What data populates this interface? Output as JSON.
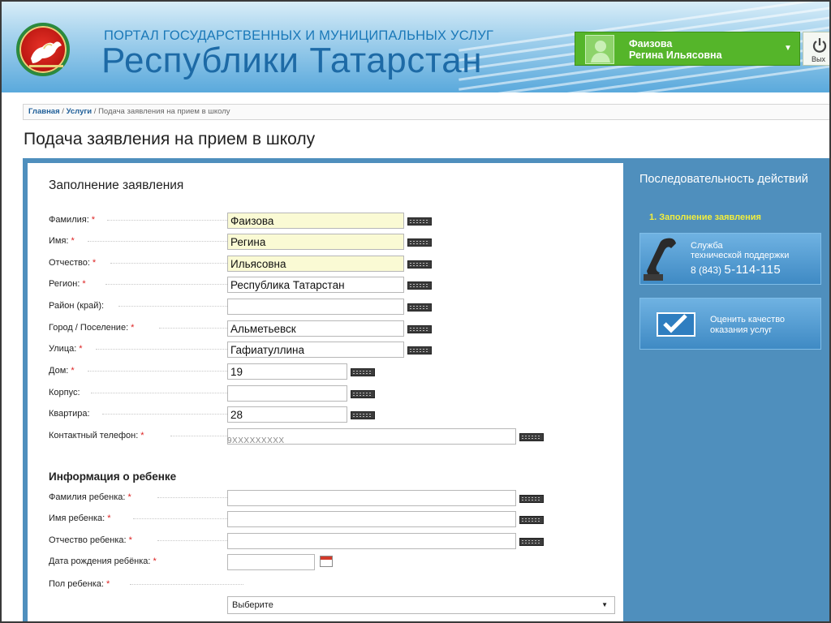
{
  "header": {
    "subtitle": "ПОРТАЛ ГОСУДАРСТВЕННЫХ И МУНИЦИПАЛЬНЫХ УСЛУГ",
    "title": "Республики Татарстан",
    "user_line1": "Фаизова",
    "user_line2": "Регина Ильясовна",
    "logout_label": "Вых"
  },
  "breadcrumb": {
    "home": "Главная",
    "services": "Услуги",
    "current": "Подача заявления на прием в школу"
  },
  "page_title": "Подача заявления на прием в школу",
  "form": {
    "section_title": "Заполнение заявления",
    "fields": [
      {
        "label": "Фамилия:",
        "value": "Фаизова"
      },
      {
        "label": "Имя:",
        "value": "Регина"
      },
      {
        "label": "Отчество:",
        "value": "Ильясовна"
      },
      {
        "label": "Регион:",
        "value": "Республика Татарстан"
      },
      {
        "label": "Район (край):",
        "value": ""
      },
      {
        "label": "Город / Поселение:",
        "value": "Альметьевск"
      },
      {
        "label": "Улица:",
        "value": "Гафиатуллина"
      },
      {
        "label": "Дом:",
        "value": "19"
      },
      {
        "label": "Корпус:",
        "value": ""
      },
      {
        "label": "Квартира:",
        "value": "28"
      },
      {
        "label": "Контактный телефон:",
        "value": ""
      }
    ],
    "phone_hint": "9XXXXXXXXX",
    "child_section_title": "Информация о ребенке",
    "child_fields": [
      {
        "label": "Фамилия ребенка:",
        "value": ""
      },
      {
        "label": "Имя ребенка:",
        "value": ""
      },
      {
        "label": "Отчество ребенка:",
        "value": ""
      },
      {
        "label": "Дата рождения ребёнка:",
        "value": ""
      }
    ],
    "gender_label": "Пол ребенка:",
    "gender_select": "Выберите",
    "required_mark": "*"
  },
  "sidebar": {
    "title": "Последовательность действий",
    "step": "1.  Заполнение заявления",
    "support_line1": "Служба",
    "support_line2": "технической поддержки",
    "support_phone_prefix": "8 (843)",
    "support_phone": "5-114-115",
    "rate_line1": "Оценить качество",
    "rate_line2": "оказания услуг"
  }
}
